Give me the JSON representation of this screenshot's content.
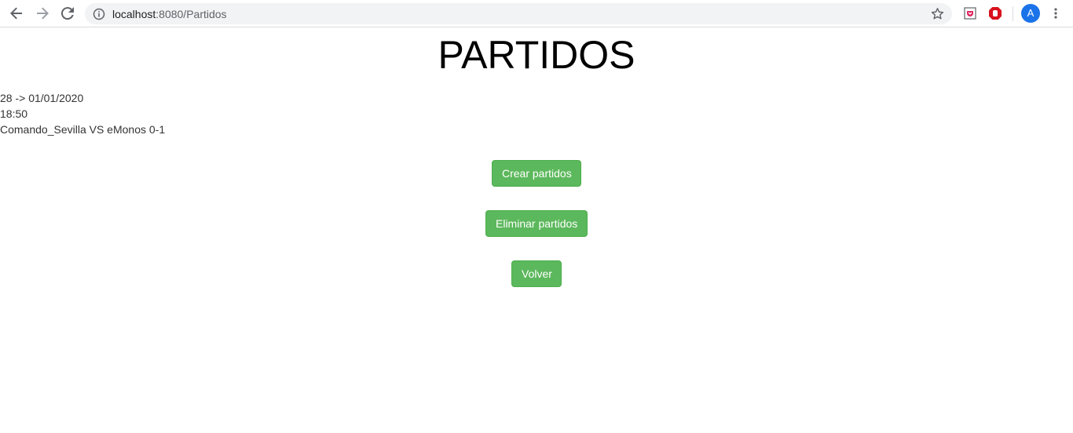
{
  "browser": {
    "url_host": "localhost",
    "url_rest": ":8080/Partidos",
    "avatar_letter": "A",
    "icons": {
      "back": "arrow-left-icon",
      "forward": "arrow-right-icon",
      "reload": "reload-icon",
      "info": "info-icon",
      "bookmark": "star-icon",
      "extension1": "pocket-icon",
      "extension2": "adblock-icon",
      "menu": "kebab-menu-icon"
    }
  },
  "page": {
    "title": "PARTIDOS",
    "match": {
      "line1": "28 -> 01/01/2020",
      "line2": "18:50",
      "line3": "Comando_Sevilla VS eMonos 0-1"
    },
    "buttons": {
      "create": "Crear partidos",
      "delete": "Eliminar partidos",
      "back": "Volver"
    }
  },
  "colors": {
    "button_bg": "#5cb85c",
    "button_border": "#4cae4c",
    "avatar_bg": "#1a73e8"
  }
}
